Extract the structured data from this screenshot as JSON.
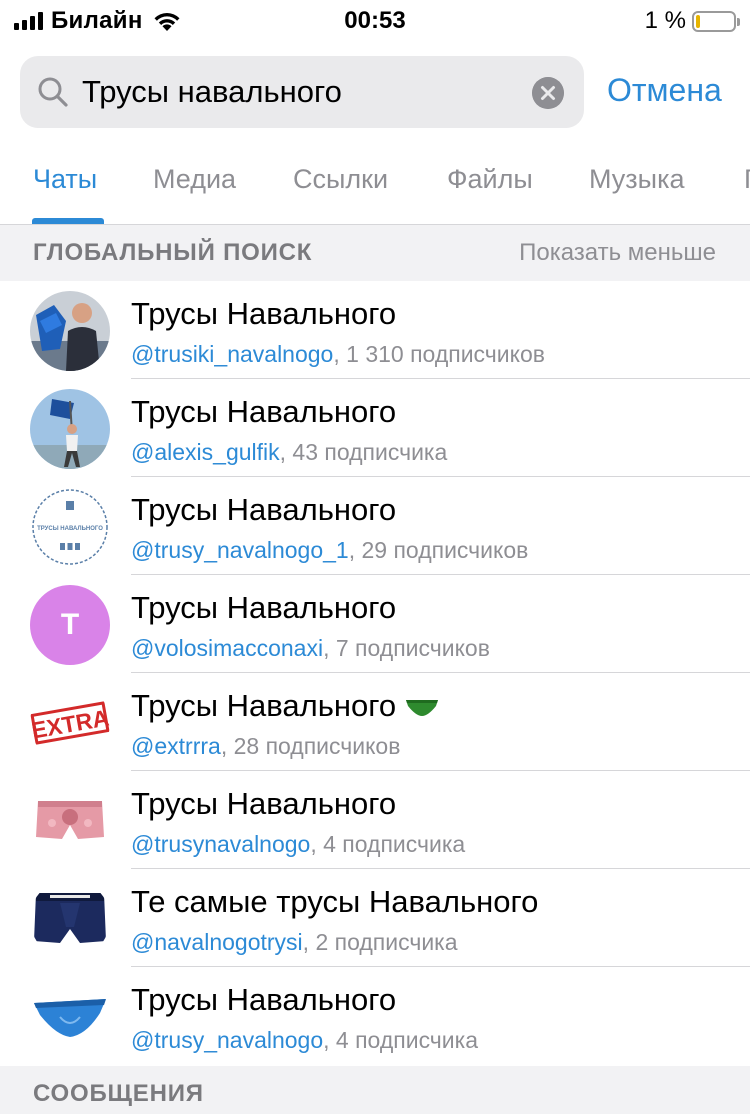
{
  "status_bar": {
    "carrier": "Билайн",
    "time": "00:53",
    "battery_percent": "1 %"
  },
  "search": {
    "value": "Трусы навального",
    "cancel_label": "Отмена"
  },
  "tabs": [
    {
      "label": "Чаты",
      "active": true
    },
    {
      "label": "Медиа",
      "active": false
    },
    {
      "label": "Ссылки",
      "active": false
    },
    {
      "label": "Файлы",
      "active": false
    },
    {
      "label": "Музыка",
      "active": false
    },
    {
      "label": "Г",
      "active": false
    }
  ],
  "global_search": {
    "title": "ГЛОБАЛЬНЫЙ ПОИСК",
    "toggle_label": "Показать меньше"
  },
  "results": [
    {
      "title": "Трусы Навального",
      "handle": "@trusiki_navalnogo",
      "subscribers": ", 1 310 подписчиков",
      "avatar": "photo-man-with-shorts-icon"
    },
    {
      "title": "Трусы Навального",
      "handle": "@alexis_gulfik",
      "subscribers": ", 43 подписчика",
      "avatar": "photo-man-with-flag-icon"
    },
    {
      "title": "Трусы Навального",
      "handle": "@trusy_navalnogo_1",
      "subscribers": ", 29 подписчиков",
      "avatar": "stamp-logo-icon",
      "avatar_text": "ТРУСЫ НАВАЛЬНОГО"
    },
    {
      "title": "Трусы Навального",
      "handle": "@volosimacconaxi",
      "subscribers": ", 7 подписчиков",
      "avatar": "letter-avatar",
      "avatar_letter": "Т",
      "avatar_color": "#d983e8"
    },
    {
      "title": "Трусы Навального",
      "handle": "@extrrra",
      "subscribers": ", 28 подписчиков",
      "avatar": "extra-stamp-icon",
      "avatar_text": "EXTRA",
      "emoji": "green-briefs-icon"
    },
    {
      "title": "Трусы Навального",
      "handle": "@trusynavalnogo",
      "subscribers": ", 4 подписчика",
      "avatar": "pink-boxers-icon"
    },
    {
      "title": "Те самые трусы Навального",
      "handle": "@navalnogotrysi",
      "subscribers": ", 2 подписчика",
      "avatar": "navy-boxer-briefs-icon"
    },
    {
      "title": "Трусы Навального",
      "handle": "@trusy_navalnogo",
      "subscribers": ", 4 подписчика",
      "avatar": "blue-briefs-icon"
    }
  ],
  "messages": {
    "title": "СООБЩЕНИЯ"
  },
  "colors": {
    "accent": "#2c8ad6",
    "secondary_text": "#8e8e93",
    "section_bg": "#f2f2f4"
  }
}
